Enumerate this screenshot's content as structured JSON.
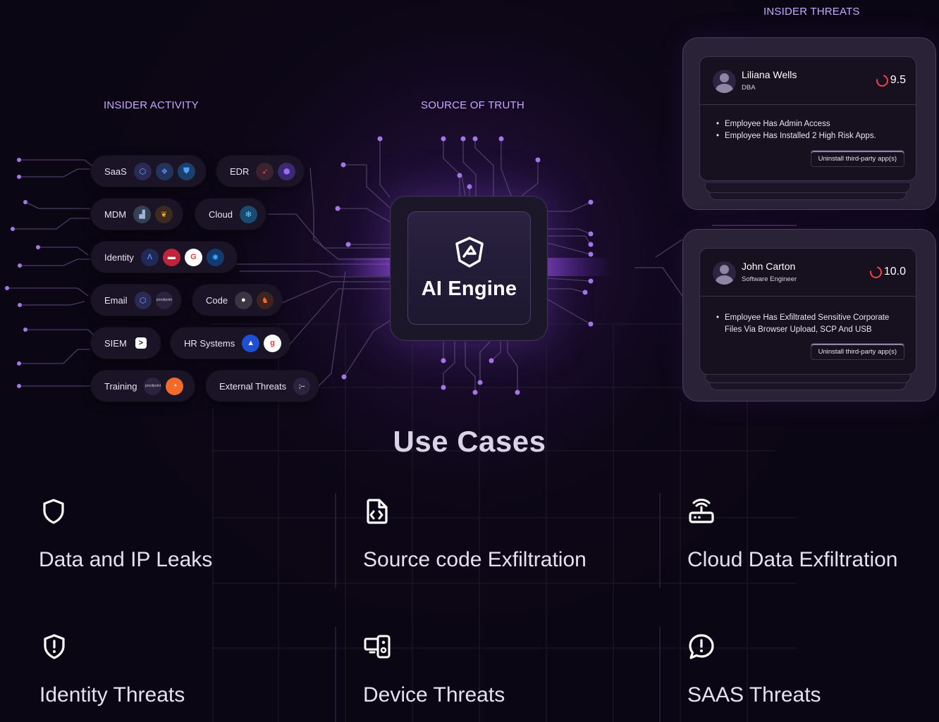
{
  "sections": {
    "insider_activity": "INSIDER ACTIVITY",
    "source_of_truth": "SOURCE OF TRUTH",
    "insider_threats": "INSIDER THREATS"
  },
  "integrations": [
    {
      "label": "SaaS",
      "icons": [
        "dropbox-icon-a",
        "dropbox-icon",
        "defender-icon"
      ]
    },
    {
      "label": "EDR",
      "icons": [
        "crowdstrike-icon",
        "sentinelone-icon"
      ]
    },
    {
      "label": "MDM",
      "icons": [
        "jamf-icon",
        "kandji-icon"
      ]
    },
    {
      "label": "Cloud",
      "icons": [
        "snowflake-icon"
      ]
    },
    {
      "label": "Identity",
      "icons": [
        "okta-icon",
        "jumpcloud-icon",
        "google-icon",
        "azure-ad-icon"
      ]
    },
    {
      "label": "Email",
      "icons": [
        "o365-icon",
        "proofpoint-icon"
      ]
    },
    {
      "label": "Code",
      "icons": [
        "github-icon",
        "gitlab-icon"
      ]
    },
    {
      "label": "SIEM",
      "icons": [
        "sentinel-icon"
      ]
    },
    {
      "label": "HR Systems",
      "icons": [
        "hris-icon",
        "gusto-icon"
      ]
    },
    {
      "label": "Training",
      "icons": [
        "proofpoint-icon",
        "knowbe4-icon"
      ]
    },
    {
      "label": "External Threats",
      "icons": [
        "recorded-future-icon"
      ]
    }
  ],
  "icon_text": {
    "proofpoint": "proofpoint",
    "google": "G",
    "gusto": "g",
    "siem": ">",
    "recorded": ";--"
  },
  "engine": {
    "title": "AI Engine"
  },
  "threat_cards": [
    {
      "name": "Liliana Wells",
      "role": "DBA",
      "score": "9.5",
      "bullets": [
        "Employee Has Admin Access",
        "Employee Has Installed 2 High Risk Apps."
      ],
      "action": "Uninstall third-party app(s)"
    },
    {
      "name": "John Carton",
      "role": "Software Engineer",
      "score": "10.0",
      "bullets": [
        "Employee Has Exfiltrated Sensitive Corporate Files Via Browser Upload, SCP And USB"
      ],
      "action": "Uninstall third-party app(s)"
    }
  ],
  "use_cases": {
    "title": "Use Cases",
    "items": [
      {
        "label": "Data and IP Leaks",
        "icon": "shield-icon"
      },
      {
        "label": "Source code Exfiltration",
        "icon": "code-file-icon"
      },
      {
        "label": "Cloud Data Exfiltration",
        "icon": "router-icon"
      },
      {
        "label": "Identity Threats",
        "icon": "shield-alert-icon"
      },
      {
        "label": "Device Threats",
        "icon": "devices-icon"
      },
      {
        "label": "SAAS Threats",
        "icon": "chat-alert-icon"
      }
    ]
  },
  "colors": {
    "accent": "#a855f7",
    "label": "#c9a8ff",
    "score_ring": "#ff3b4e",
    "background": "#0b0614"
  }
}
